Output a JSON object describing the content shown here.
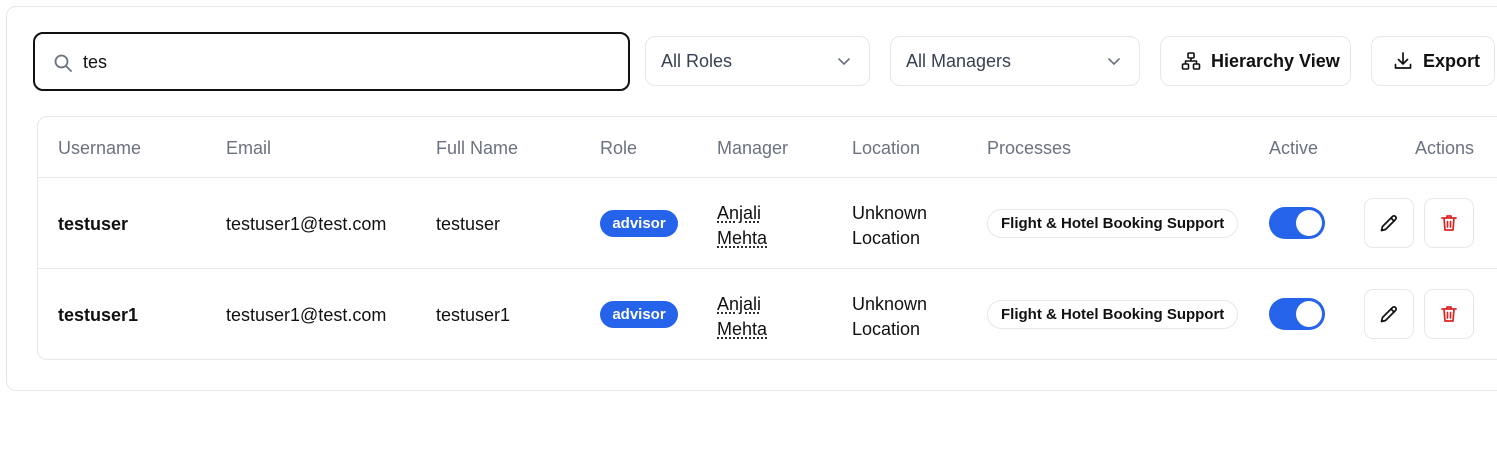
{
  "search": {
    "value": "tes",
    "icon": "search-icon"
  },
  "filters": {
    "roles": {
      "selected": "All Roles"
    },
    "managers": {
      "selected": "All Managers"
    }
  },
  "toolbar": {
    "hierarchy_label": "Hierarchy View",
    "export_label": "Export"
  },
  "table": {
    "columns": [
      "Username",
      "Email",
      "Full Name",
      "Role",
      "Manager",
      "Location",
      "Processes",
      "Active",
      "Actions"
    ],
    "rows": [
      {
        "username": "testuser",
        "email": "testuser1@test.com",
        "full_name": "testuser",
        "role": "advisor",
        "manager_first": "Anjali",
        "manager_last": "Mehta",
        "location_line1": "Unknown",
        "location_line2": "Location",
        "process": "Flight & Hotel Booking Support",
        "active": true
      },
      {
        "username": "testuser1",
        "email": "testuser1@test.com",
        "full_name": "testuser1",
        "role": "advisor",
        "manager_first": "Anjali",
        "manager_last": "Mehta",
        "location_line1": "Unknown",
        "location_line2": "Location",
        "process": "Flight & Hotel Booking Support",
        "active": true
      }
    ]
  },
  "colors": {
    "accent": "#2563eb",
    "danger": "#dc2626",
    "border": "#e5e7eb",
    "header_text": "#6b7280"
  }
}
